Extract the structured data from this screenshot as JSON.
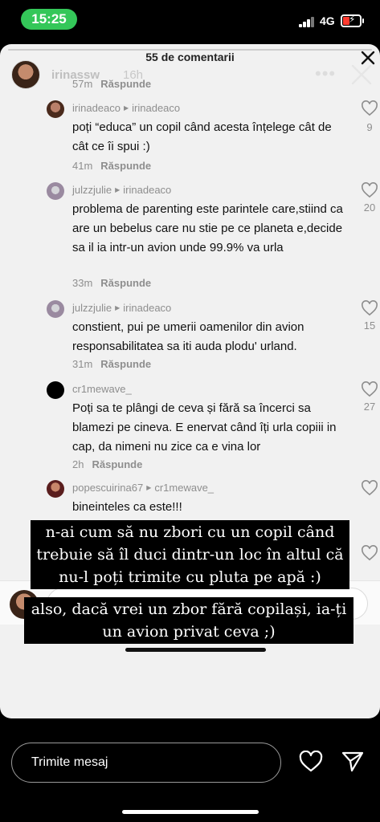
{
  "status_bar": {
    "time": "15:25",
    "network": "4G"
  },
  "story": {
    "username": "irinassw",
    "time_ago": "16h"
  },
  "comments_panel": {
    "title": "55 de comentarii",
    "top_meta": {
      "time": "57m",
      "reply": "Răspunde"
    },
    "comments": [
      {
        "user": "irinadeaco",
        "reply_to": "irinadeaco",
        "text": "poți “educa” un copil când acesta înțelege cât de cât ce îi spui :)",
        "time": "41m",
        "reply": "Răspunde",
        "likes": "9"
      },
      {
        "user": "julzzjulie",
        "reply_to": "irinadeaco",
        "text": "problema de parenting este parintele care,stiind ca are un bebelus care nu stie pe ce planeta e,decide sa il ia intr-un avion unde 99.9% va urla",
        "time": "33m",
        "reply": "Răspunde",
        "likes": "20"
      },
      {
        "user": "julzzjulie",
        "reply_to": "irinadeaco",
        "text": "constient, pui pe umerii oamenilor din avion responsabilitatea sa iti auda plodu' urland.",
        "time": "31m",
        "reply": "Răspunde",
        "likes": "15"
      },
      {
        "user": "cr1mewave_",
        "reply_to": "",
        "text": "Poți sa te plângi de ceva și fără sa încerci sa blamezi pe cineva. E enervat când îți urla copiii in cap, da nimeni nu zice ca e vina lor",
        "time": "2h",
        "reply": "Răspunde",
        "likes": "27"
      },
      {
        "user": "popescuirina67",
        "reply_to": "cr1mewave_",
        "text": "bineinteles ca este!!!",
        "time": "",
        "reply": "",
        "likes": ""
      }
    ]
  },
  "overlays": {
    "text_1": "n-ai cum să nu zbori cu un copil când trebuie să îl duci dintr-un loc în altul că nu-l poți trimite cu pluta pe apă :)",
    "text_2": "also, dacă vrei un zbor fără copilași, ia-ți un avion privat ceva ;)"
  },
  "bottom_bar": {
    "message_placeholder": "Trimite mesaj"
  },
  "colors": {
    "time_pill": "#34c759",
    "battery_low": "#ff3b30"
  }
}
